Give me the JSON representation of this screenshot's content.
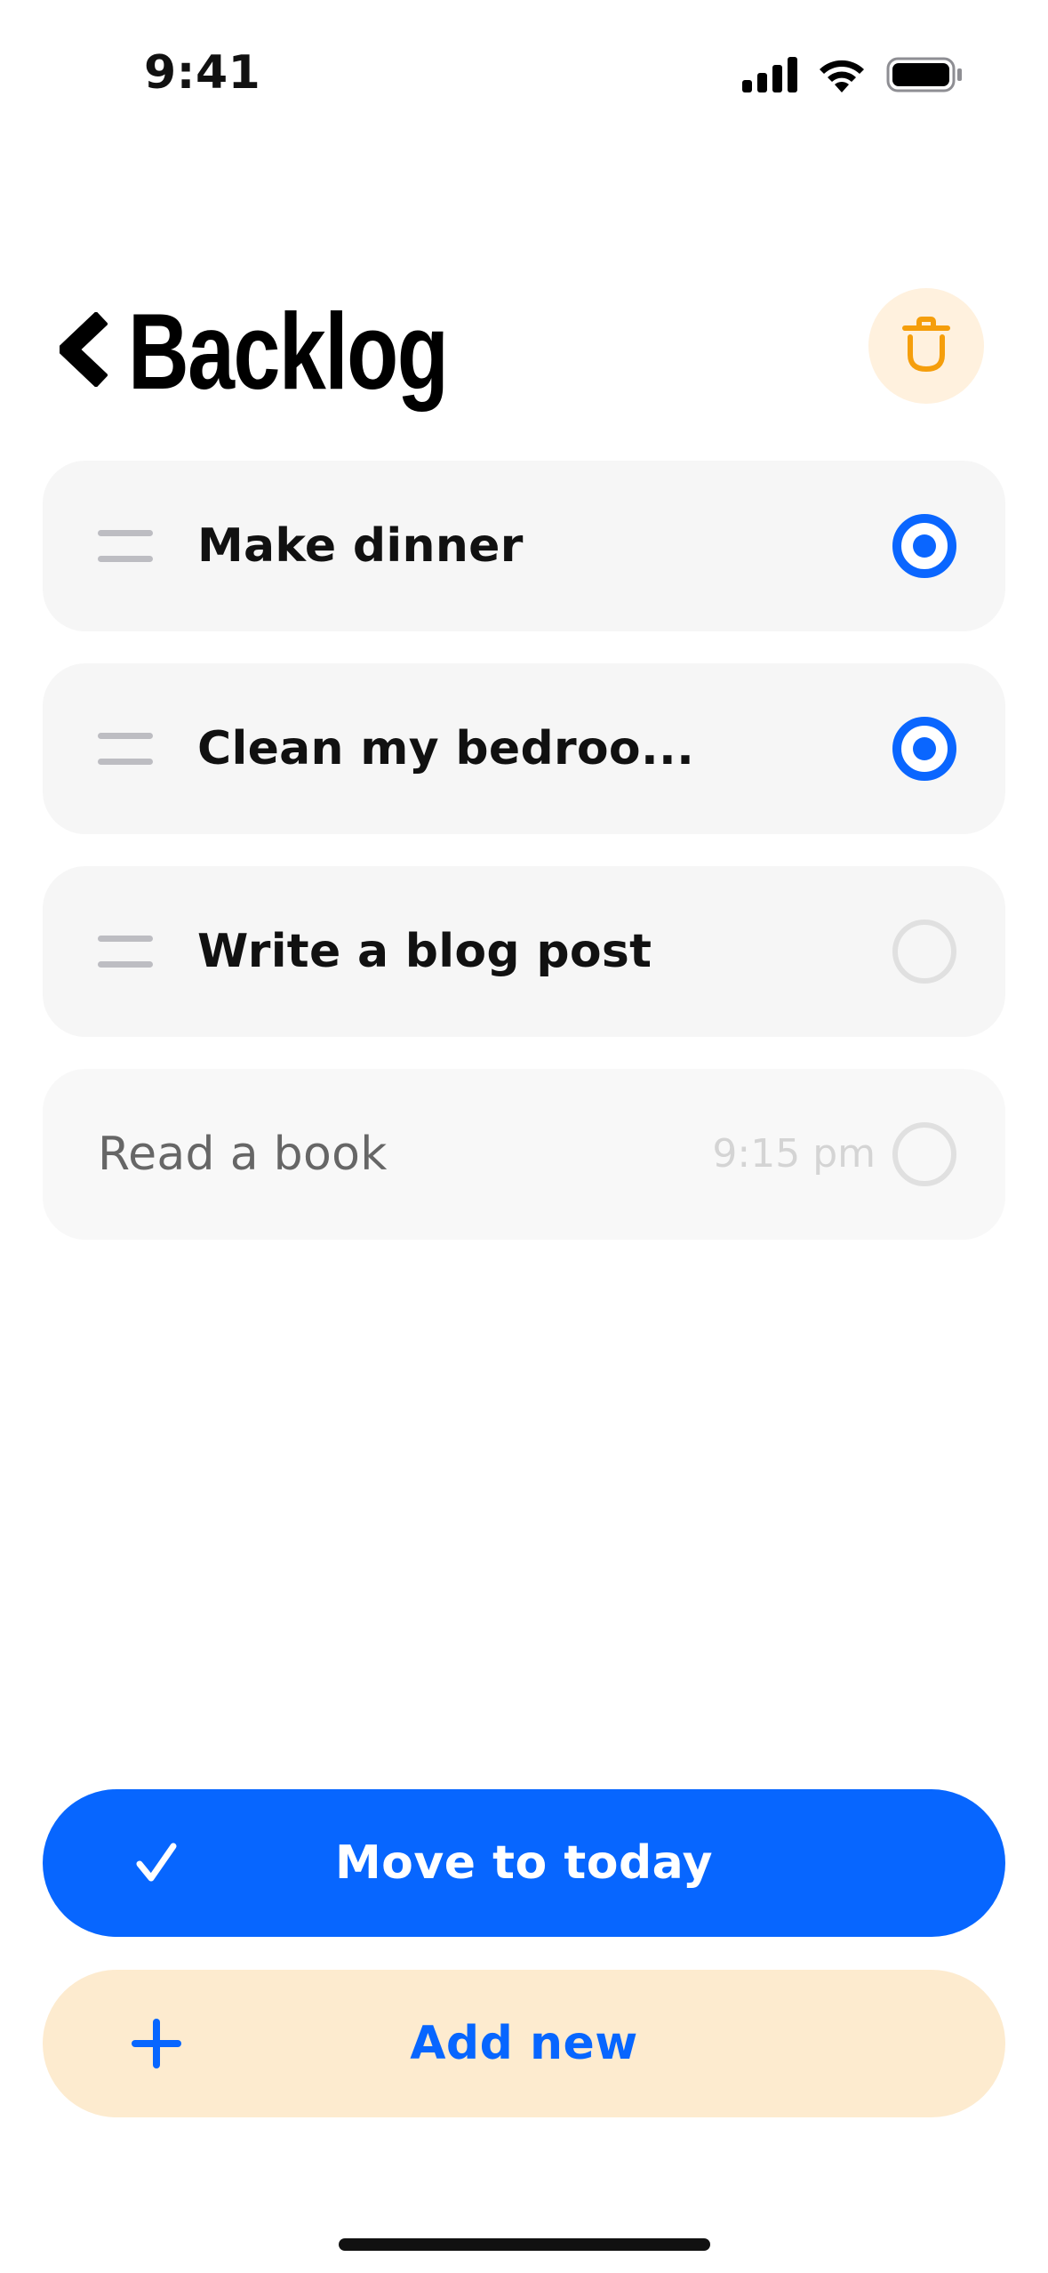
{
  "status_bar": {
    "time": "9:41",
    "icons": [
      "cellular-signal-icon",
      "wifi-icon",
      "battery-icon"
    ]
  },
  "header": {
    "title": "Backlog",
    "back_icon": "chevron-left-icon",
    "trash_icon": "trash-icon"
  },
  "tasks": [
    {
      "label": "Make dinner",
      "time": "",
      "selected": true,
      "draggable": true
    },
    {
      "label": "Clean my bedroo...",
      "time": "",
      "selected": true,
      "draggable": true
    },
    {
      "label": "Write a blog post",
      "time": "",
      "selected": false,
      "draggable": true
    },
    {
      "label": "Read a book",
      "time": "9:15 pm",
      "selected": false,
      "draggable": false
    }
  ],
  "actions": {
    "move_label": "Move to today",
    "move_icon": "checkmark-icon",
    "add_label": "Add new",
    "add_icon": "plus-icon"
  },
  "colors": {
    "accent": "#0766FF",
    "trash_background": "#FFF1DE",
    "trash_icon": "#F59E0B",
    "add_background": "#FDEBCF",
    "row_background": "#F6F6F6"
  }
}
